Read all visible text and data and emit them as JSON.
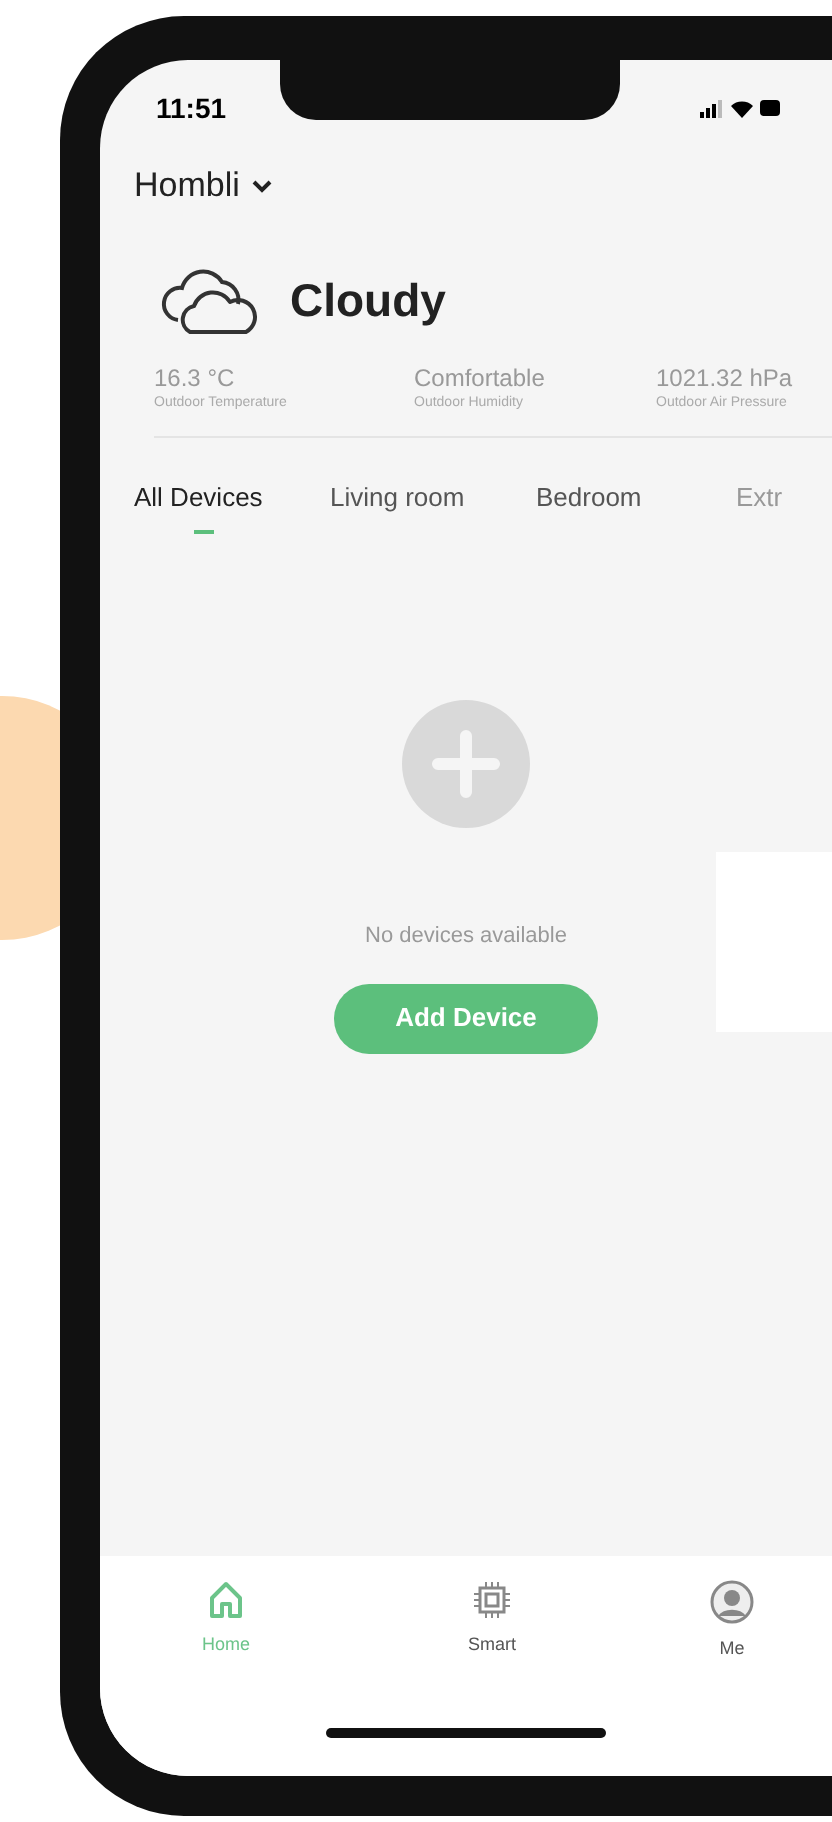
{
  "status_bar": {
    "time": "11:51"
  },
  "header": {
    "home_name": "Hombli"
  },
  "weather": {
    "condition": "Cloudy",
    "stats": [
      {
        "value": "16.3 °C",
        "label": "Outdoor Temperature"
      },
      {
        "value": "Comfortable",
        "label": "Outdoor Humidity"
      },
      {
        "value": "1021.32 hPa",
        "label": "Outdoor Air Pressure"
      }
    ]
  },
  "tabs": [
    {
      "label": "All Devices",
      "selected": true
    },
    {
      "label": "Living room",
      "selected": false
    },
    {
      "label": "Bedroom",
      "selected": false
    },
    {
      "label": "Extr",
      "selected": false
    }
  ],
  "empty_state": {
    "message": "No devices available",
    "button": "Add Device"
  },
  "bottom_nav": [
    {
      "label": "Home",
      "kind": "home",
      "selected": true
    },
    {
      "label": "Smart",
      "kind": "smart",
      "selected": false
    },
    {
      "label": "Me",
      "kind": "me",
      "selected": false
    }
  ]
}
